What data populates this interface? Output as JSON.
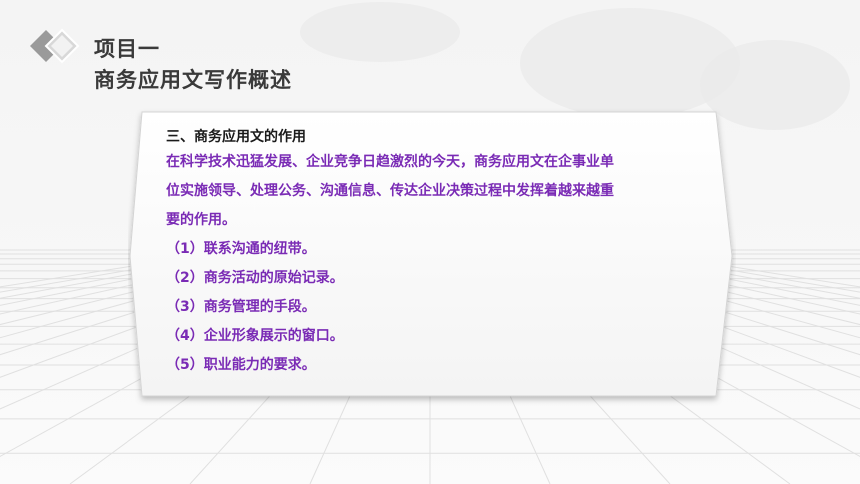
{
  "header": {
    "title_line1": "项目一",
    "title_line2": "商务应用文写作概述"
  },
  "card": {
    "heading": "三、商务应用文的作用",
    "intro_lines": [
      "在科学技术迅猛发展、企业竞争日趋激烈的今天，商务应用文在企事业单",
      "位实施领导、处理公务、沟通信息、传达企业决策过程中发挥着越来越重",
      "要的作用。"
    ],
    "points": [
      "（1）联系沟通的纽带。",
      "（2）商务活动的原始记录。",
      "（3）商务管理的手段。",
      "（4）企业形象展示的窗口。",
      "（5）职业能力的要求。"
    ]
  },
  "colors": {
    "title_text": "#3a3a3a",
    "heading_text": "#1a1a1a",
    "accent_purple": "#7a2bb5"
  },
  "icons": {
    "logo": "double-diamond-icon"
  }
}
